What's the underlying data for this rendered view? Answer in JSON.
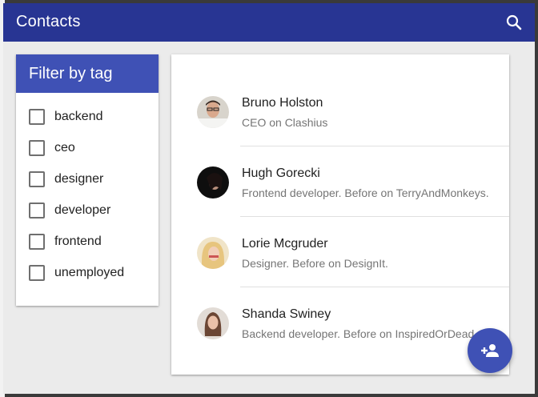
{
  "appbar": {
    "title": "Contacts",
    "search_icon": "search-icon",
    "background": "#283593"
  },
  "filter": {
    "title": "Filter by tag",
    "header_color": "#3f51b5",
    "tags": [
      {
        "label": "backend",
        "checked": false
      },
      {
        "label": "ceo",
        "checked": false
      },
      {
        "label": "designer",
        "checked": false
      },
      {
        "label": "developer",
        "checked": false
      },
      {
        "label": "frontend",
        "checked": false
      },
      {
        "label": "unemployed",
        "checked": false
      }
    ]
  },
  "contacts": [
    {
      "name": "Bruno Holston",
      "description": "CEO on Clashius",
      "avatar_color": "#e8e4dc"
    },
    {
      "name": "Hugh Gorecki",
      "description": "Frontend developer. Before on TerryAndMonkeys.",
      "avatar_color": "#111111"
    },
    {
      "name": "Lorie Mcgruder",
      "description": "Designer. Before on DesignIt.",
      "avatar_color": "#e8c98a"
    },
    {
      "name": "Shanda Swiney",
      "description": "Backend developer. Before on InspiredOrDead",
      "avatar_color": "#d9d2cc"
    }
  ],
  "fab": {
    "icon": "person-add-icon",
    "color": "#3f51b5"
  }
}
